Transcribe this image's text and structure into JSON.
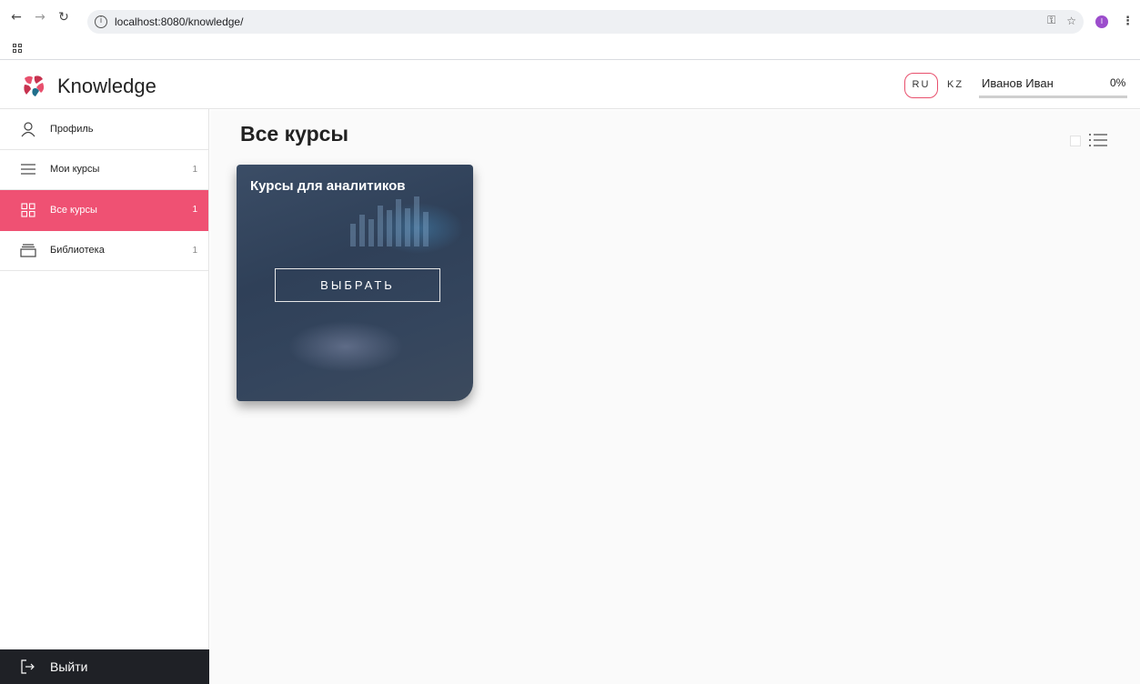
{
  "browser": {
    "url": "localhost:8080/knowledge/",
    "back_icon": "arrow-left-icon",
    "forward_icon": "arrow-right-icon",
    "reload_icon": "reload-icon",
    "profile_initial": "I"
  },
  "header": {
    "app_name": "Knowledge",
    "lang_ru": "RU",
    "lang_kz": "KZ",
    "user_name": "Иванов Иван",
    "progress_label": "0%",
    "progress_value": 0,
    "accent_color": "#ef5173"
  },
  "sidebar": {
    "items": [
      {
        "label": "Профиль",
        "count": "",
        "icon": "user-icon"
      },
      {
        "label": "Мои курсы",
        "count": "1",
        "icon": "menu-icon"
      },
      {
        "label": "Все курсы",
        "count": "1",
        "icon": "grid-icon",
        "active": true
      },
      {
        "label": "Библиотека",
        "count": "1",
        "icon": "library-icon"
      }
    ],
    "logout_label": "Выйти"
  },
  "main": {
    "title": "Все курсы",
    "courses": [
      {
        "title": "Курсы для аналитиков",
        "button_label": "ВЫБРАТЬ"
      }
    ]
  }
}
